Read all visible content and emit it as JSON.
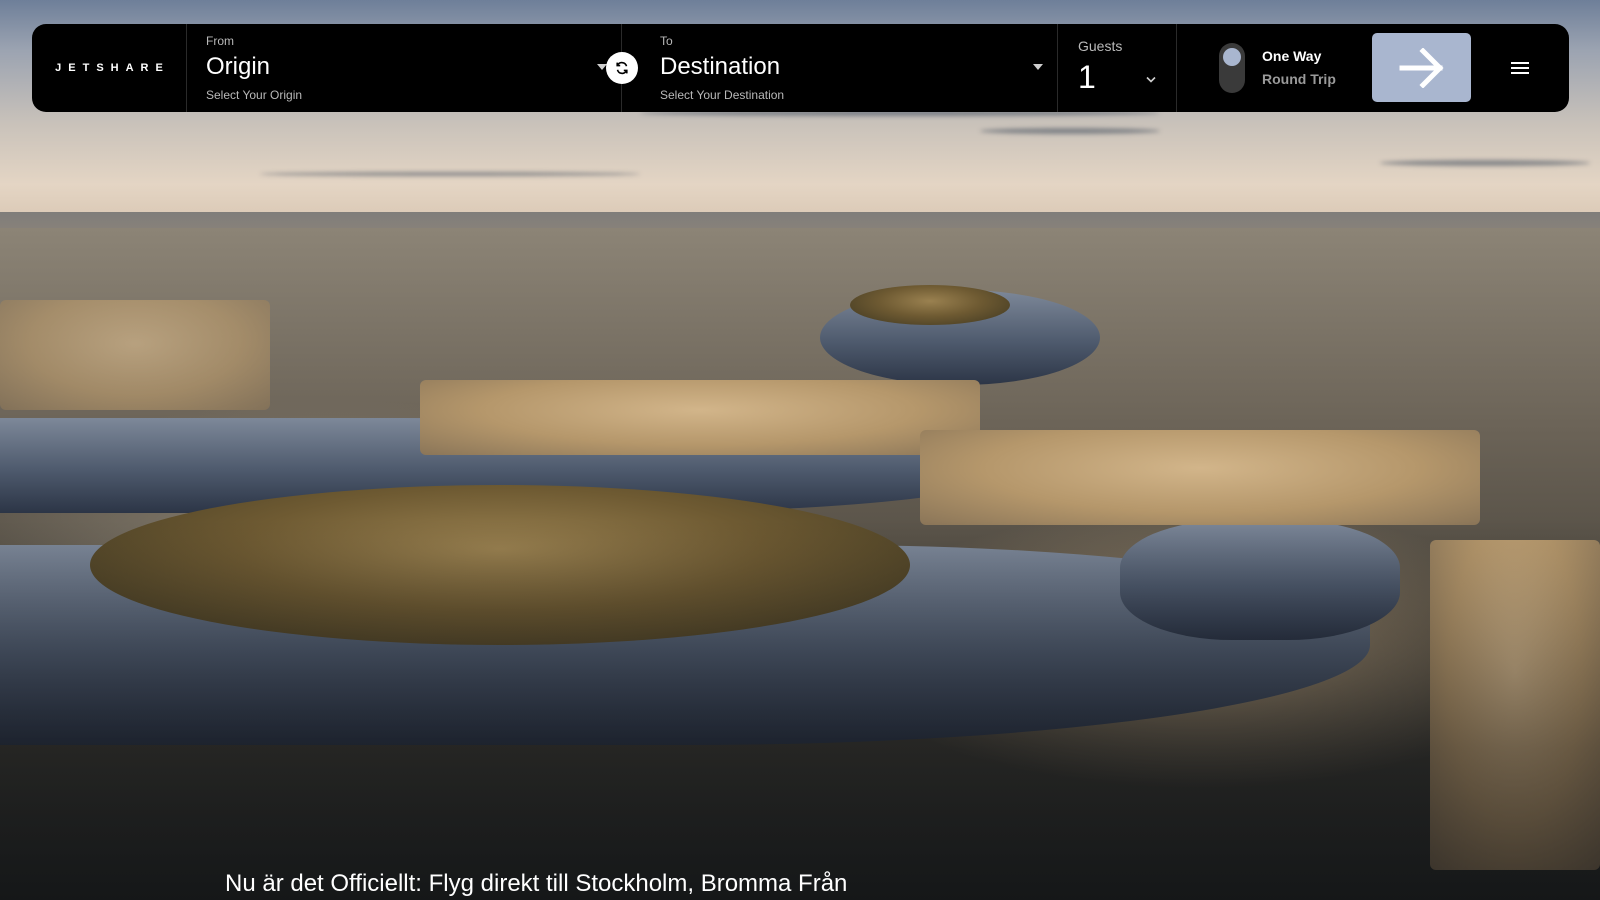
{
  "brand": {
    "logo_text": "JETSHARE"
  },
  "search": {
    "from": {
      "label": "From",
      "value": "Origin",
      "hint": "Select Your Origin"
    },
    "swap_icon": "swap-arrows-icon",
    "to": {
      "label": "To",
      "value": "Destination",
      "hint": "Select Your Destination"
    },
    "guests": {
      "label": "Guests",
      "value": "1"
    },
    "trip_type": {
      "options": [
        "One Way",
        "Round Trip"
      ],
      "selected": "One Way"
    },
    "submit_icon": "arrow-right-icon",
    "menu_icon": "hamburger-menu-icon"
  },
  "hero": {
    "headline": "Nu är det Officiellt: Flyg direkt till Stockholm, Bromma Från"
  },
  "colors": {
    "bar_bg": "#000000",
    "accent": "#a9b6cf",
    "text": "#ffffff",
    "muted": "#b9b9b9"
  }
}
